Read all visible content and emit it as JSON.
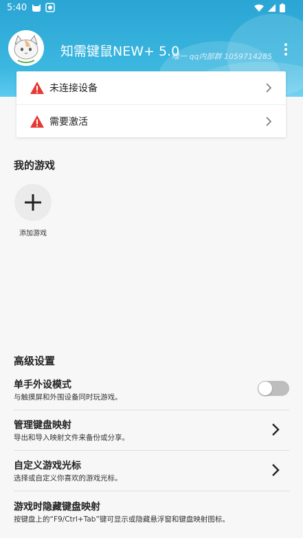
{
  "status_bar": {
    "time": "5:40"
  },
  "header": {
    "title": "知需键鼠NEW+ 5.0",
    "watermark": "唯一 qq内部群 1059714285",
    "background_color": "#2aa5d4"
  },
  "device_card": {
    "items": [
      {
        "label": "未连接设备",
        "icon": "warning-icon",
        "icon_color": "#e53935"
      },
      {
        "label": "需要激活",
        "icon": "warning-icon",
        "icon_color": "#e53935"
      }
    ]
  },
  "my_games": {
    "title": "我的游戏",
    "add_label": "添加游戏"
  },
  "advanced": {
    "title": "高级设置",
    "items": [
      {
        "title": "单手外设模式",
        "desc": "与触摸屏和外围设备同时玩游戏。",
        "control": "toggle",
        "enabled": false
      },
      {
        "title": "管理键盘映射",
        "desc": "导出和导入映射文件来备份或分享。",
        "control": "chevron"
      },
      {
        "title": "自定义游戏光标",
        "desc": "选择或自定义你喜欢的游戏光标。",
        "control": "chevron"
      },
      {
        "title": "游戏时隐藏键盘映射",
        "desc": "按键盘上的“F9/Ctrl+Tab”键可显示或隐藏悬浮窗和键盘映射图标。",
        "control": "none"
      }
    ]
  }
}
